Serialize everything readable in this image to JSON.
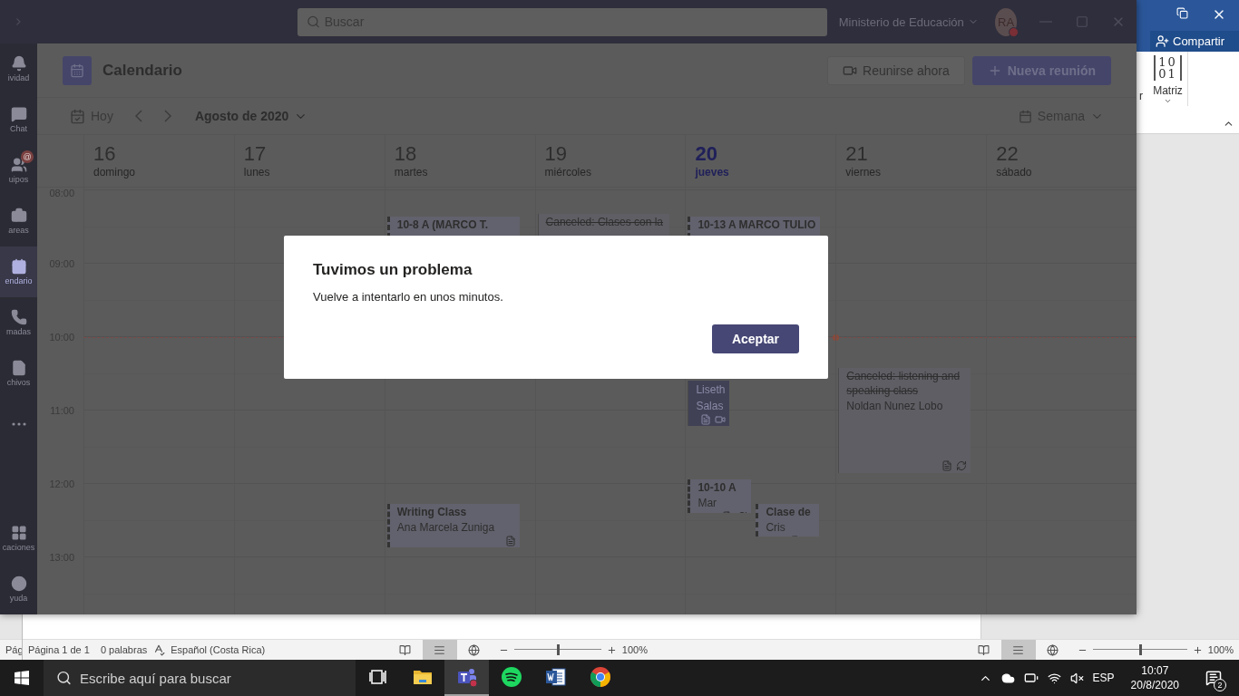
{
  "teams": {
    "search": {
      "placeholder": "Buscar"
    },
    "org": "Ministerio de Educación",
    "avatar": {
      "initials": "RA",
      "busy": true
    },
    "rail": [
      {
        "kind": "activity",
        "label": "ividad",
        "selected": false
      },
      {
        "kind": "chat",
        "label": "Chat",
        "selected": false
      },
      {
        "kind": "teams",
        "label": "uipos",
        "selected": false,
        "badge": "@"
      },
      {
        "kind": "assignments",
        "label": "areas",
        "selected": false
      },
      {
        "kind": "calendar",
        "label": "endario",
        "selected": true
      },
      {
        "kind": "calls",
        "label": "madas",
        "selected": false
      },
      {
        "kind": "files",
        "label": "chivos",
        "selected": false
      },
      {
        "kind": "more",
        "selected": false
      },
      {
        "kind": "apps",
        "label": "caciones",
        "selected": false
      },
      {
        "kind": "help",
        "label": "yuda",
        "selected": false
      }
    ],
    "page_title": "Calendario",
    "actions": [
      {
        "kind": "meet",
        "label": "Reunirse ahora"
      },
      {
        "kind": "new",
        "label": "Nueva reunión"
      }
    ],
    "nav": {
      "today": "Hoy",
      "month": "Agosto de 2020",
      "view": "Semana"
    },
    "hours": [
      "08:00",
      "09:00",
      "10:00",
      "11:00",
      "12:00",
      "13:00"
    ],
    "days": [
      {
        "number": "16",
        "weekday": "domingo",
        "selected": false
      },
      {
        "number": "17",
        "weekday": "lunes",
        "selected": false
      },
      {
        "number": "18",
        "weekday": "martes",
        "selected": false,
        "events": [
          {
            "title": "10-8 A (MARCO T.",
            "tentative": true,
            "canceled": false,
            "highlighted": false
          },
          {
            "title": "Writing Class",
            "organizer": "Ana Marcela Zuniga",
            "tentative": true,
            "canceled": false,
            "highlighted": false,
            "notes": true,
            "recurring": false,
            "online": false
          }
        ]
      },
      {
        "number": "19",
        "weekday": "miércoles",
        "selected": false,
        "events": [
          {
            "title": "Canceled: Clases con la",
            "tentative": false,
            "canceled": true,
            "highlighted": false
          }
        ]
      },
      {
        "number": "20",
        "weekday": "jueves",
        "selected": true,
        "events": [
          {
            "title": "10-13 A MARCO TULIO",
            "tentative": true,
            "canceled": false,
            "highlighted": false
          },
          {
            "organizer": "Liseth Salas",
            "tentative": false,
            "highlighted": true,
            "notes": true,
            "recurring": false,
            "online": true
          },
          {
            "title": "10-10 A",
            "organizer": "Mar",
            "tentative": true,
            "canceled": false,
            "highlighted": false,
            "notes": true,
            "recurring": true,
            "online": false
          },
          {
            "title": "Clase de",
            "organizer": "Cris",
            "tentative": true,
            "canceled": false,
            "highlighted": false,
            "notes": true,
            "recurring": true,
            "online": false
          }
        ]
      },
      {
        "number": "21",
        "weekday": "viernes",
        "selected": false,
        "events": [
          {
            "title": "Canceled: listening and speaking class",
            "organizer": "Noldan Nunez Lobo",
            "tentative": false,
            "canceled": true,
            "highlighted": false,
            "notes": true,
            "recurring": true,
            "online": false
          }
        ]
      },
      {
        "number": "22",
        "weekday": "sábado",
        "selected": false
      }
    ],
    "dialog": {
      "title": "Tuvimos un problema",
      "message": "Vuelve a intentarlo en unos minutos.",
      "button": "Aceptar"
    }
  },
  "word_back": {
    "status_left": "Pág",
    "share": "Compartir",
    "ribbon_cut": "r",
    "matrix_label": "Matriz",
    "matrix_rows": [
      "10",
      "01"
    ],
    "views": [
      {
        "kind": "read",
        "selected": false
      },
      {
        "kind": "print",
        "selected": true
      },
      {
        "kind": "web",
        "selected": false
      }
    ],
    "zoom": {
      "level": 0.5,
      "reading": "100%"
    }
  },
  "word_front": {
    "page": "Página 1 de 1",
    "words": "0 palabras",
    "language": "Español (Costa Rica)",
    "views": [
      {
        "kind": "read",
        "selected": false
      },
      {
        "kind": "print",
        "selected": true
      },
      {
        "kind": "web",
        "selected": false
      }
    ],
    "zoom": {
      "level": 0.5,
      "reading": "100%"
    }
  },
  "taskbar": {
    "search_placeholder": "Escribe aquí para buscar",
    "apps": [
      {
        "kind": "taskview",
        "selected": false
      },
      {
        "kind": "explorer",
        "selected": false
      },
      {
        "kind": "teams",
        "selected": true
      },
      {
        "kind": "spotify",
        "selected": false
      },
      {
        "kind": "word",
        "selected": false
      },
      {
        "kind": "chrome",
        "selected": false
      }
    ],
    "lang": "ESP",
    "time": "10:07",
    "date": "20/8/2020",
    "notifications": "2"
  }
}
